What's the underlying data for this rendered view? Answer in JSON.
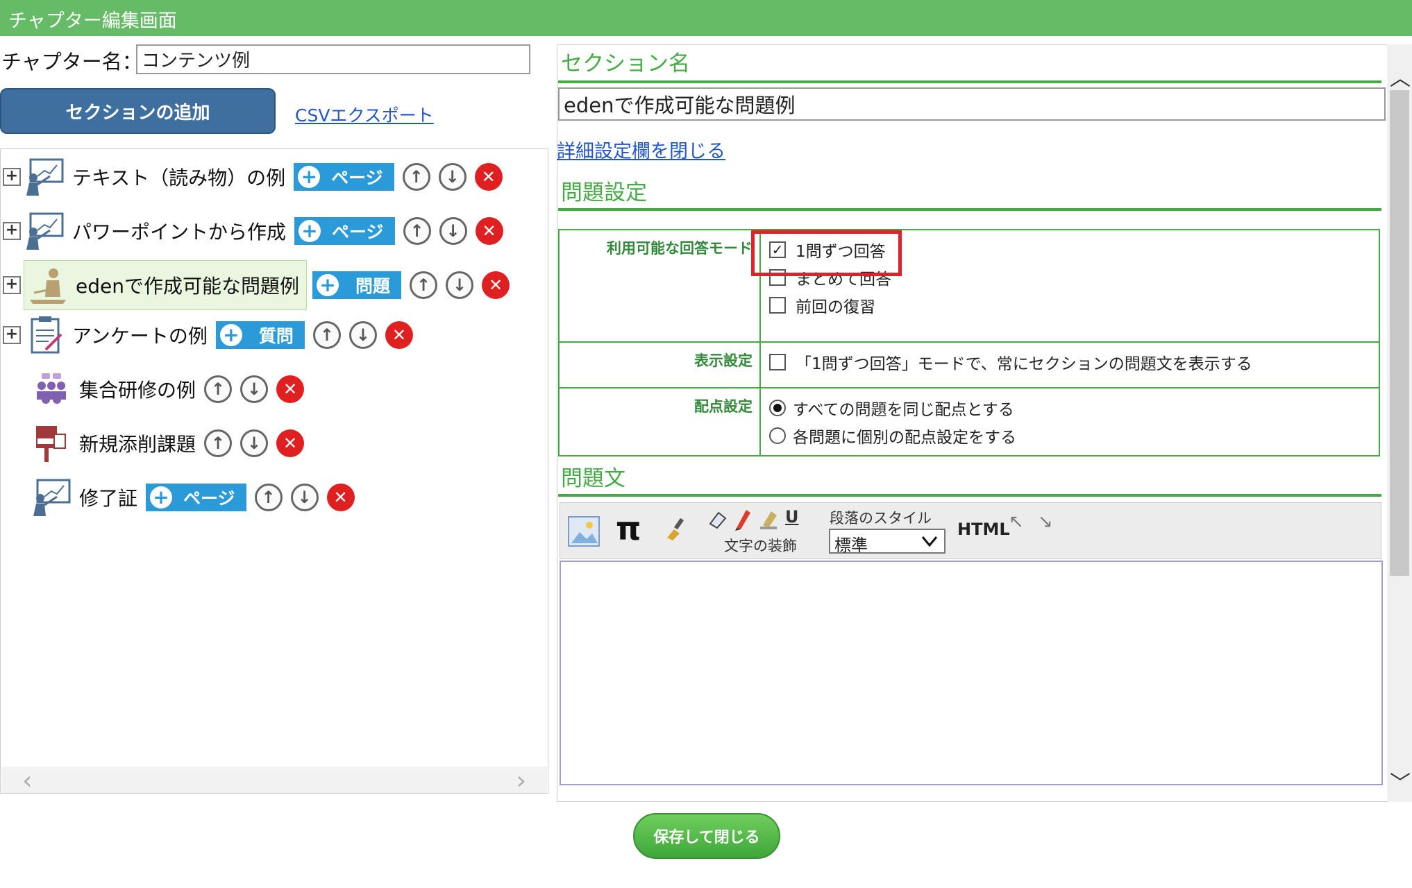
{
  "header": {
    "title": "チャプター編集画面"
  },
  "left": {
    "chapter_name_label": "チャプター名：",
    "chapter_name_value": "コンテンツ例",
    "add_section_label": "セクションの追加",
    "csv_export_label": "CSVエクスポート",
    "tree": [
      {
        "label": "テキスト（読み物）の例",
        "tag": "ページ",
        "icon": "presentation-board-icon",
        "expandable": true,
        "selected": false
      },
      {
        "label": "パワーポイントから作成",
        "tag": "ページ",
        "icon": "presentation-board-icon",
        "expandable": true,
        "selected": false
      },
      {
        "label": "edenで作成可能な問題例",
        "tag": "問題",
        "icon": "exam-person-icon",
        "expandable": true,
        "selected": true
      },
      {
        "label": "アンケートの例",
        "tag": "質問",
        "icon": "clipboard-survey-icon",
        "expandable": true,
        "selected": false
      },
      {
        "label": "集合研修の例",
        "tag": "",
        "icon": "group-training-icon",
        "expandable": false,
        "selected": false
      },
      {
        "label": "新規添削課題",
        "tag": "",
        "icon": "post-box-icon",
        "expandable": false,
        "selected": false
      },
      {
        "label": "修了証",
        "tag": "ページ",
        "icon": "presentation-board-icon",
        "expandable": false,
        "selected": false
      }
    ],
    "up_glyph": "↑",
    "down_glyph": "↓",
    "delete_glyph": "✕",
    "expand_glyph": "+",
    "scroll_left": "‹",
    "scroll_right": "›"
  },
  "right": {
    "section_name_heading": "セクション名",
    "section_name_value": "edenで作成可能な問題例",
    "detail_toggle_link": "詳細設定欄を閉じる",
    "problem_settings_heading": "問題設定",
    "answer_mode_label": "利用可能な回答モード",
    "answer_modes": [
      {
        "label": "1問ずつ回答",
        "checked": true
      },
      {
        "label": "まとめて回答",
        "checked": false
      },
      {
        "label": "前回の復習",
        "checked": false
      }
    ],
    "display_label": "表示設定",
    "display_option": "「1問ずつ回答」モードで、常にセクションの問題文を表示する",
    "scoring_label": "配点設定",
    "scoring_options": [
      {
        "label": "すべての問題を同じ配点とする",
        "selected": true
      },
      {
        "label": "各問題に個別の配点設定をする",
        "selected": false
      }
    ],
    "problem_text_heading": "問題文",
    "toolbar": {
      "pi_glyph": "π",
      "underline_glyph": "U",
      "text_decoration_label": "文字の装飾",
      "paragraph_style_label": "段落のスタイル",
      "paragraph_style_value": "標準",
      "html_label": "HTML",
      "undo_glyph": "↖",
      "redo_glyph": "↘"
    },
    "scroll_up": "︿",
    "scroll_down": "﹀"
  },
  "footer": {
    "save_close_label": "保存して閉じる"
  },
  "colors": {
    "header_green": "#66bb66",
    "heading_green": "#44aa44",
    "button_blue": "#3f6f9f",
    "tag_blue": "#2a9ad8",
    "highlight_red": "#e0202a"
  }
}
